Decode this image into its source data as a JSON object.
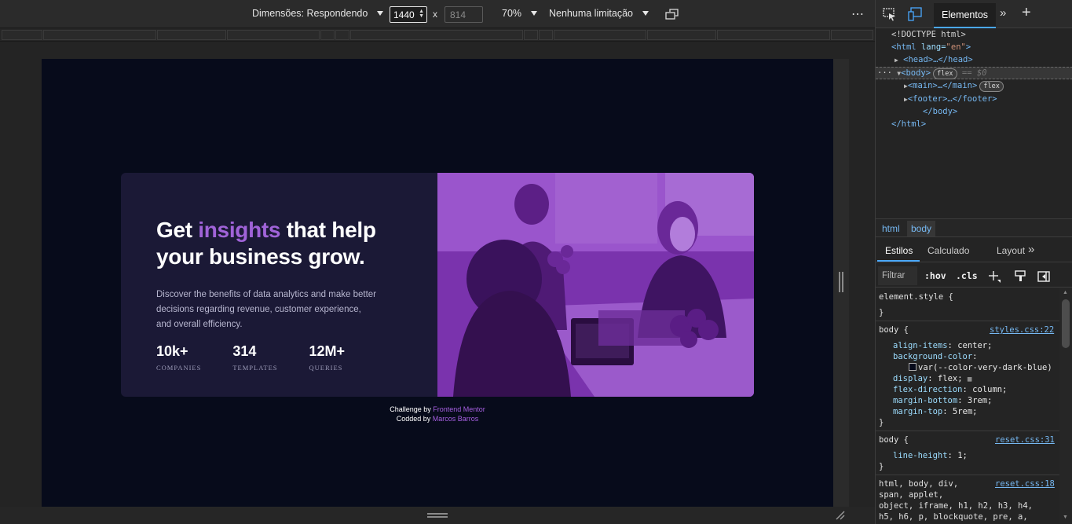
{
  "device_toolbar": {
    "dimensions_label": "Dimensões: Respondendo",
    "width": "1440",
    "times": "x",
    "height": "814",
    "zoom": "70%",
    "throttle": "Nenhuma limitação",
    "more": "⋯"
  },
  "page": {
    "headline_pre": "Get ",
    "headline_accent": "insights",
    "headline_post_line1": " that help",
    "headline_line2": "your business grow.",
    "description": "Discover the benefits of data analytics and make better decisions regarding revenue, customer experience, and overall efficiency.",
    "stats": [
      {
        "value": "10k+",
        "label": "COMPANIES"
      },
      {
        "value": "314",
        "label": "TEMPLATES"
      },
      {
        "value": "12M+",
        "label": "QUERIES"
      }
    ],
    "footer": {
      "challenge_prefix": "Challenge by ",
      "challenge_link": "Frontend Mentor",
      "coded_prefix": "Codded by ",
      "coded_link": "Marcos Barros"
    }
  },
  "devtools": {
    "tab_elements": "Elementos",
    "tab_more": "»",
    "tab_add": "+",
    "dom": {
      "doctype": "<!DOCTYPE html>",
      "html_open_tag": "<html",
      "html_attr": " lang=",
      "html_attr_val": "\"en\"",
      "html_close_bracket": ">",
      "head": "<head>…</head>",
      "body_open": "<body>",
      "body_badge": "flex",
      "body_eq": "== $0",
      "main": "<main>…</main>",
      "main_badge": "flex",
      "footer": "<footer>…</footer>",
      "body_close": "</body>",
      "html_close": "</html>",
      "dots": "···"
    },
    "breadcrumbs": [
      "html",
      "body"
    ],
    "style_tabs": [
      "Estilos",
      "Calculado",
      "Layout",
      "»"
    ],
    "filter_placeholder": "Filtrar",
    "hov": ":hov",
    "cls": ".cls",
    "rules": {
      "element_style": "element.style {",
      "close": "}",
      "r1_selector": "body {",
      "r1_source": "styles.css:22",
      "r1_props": [
        {
          "name": "align-items",
          "value": "center;"
        },
        {
          "name": "background-color",
          "value": ""
        },
        {
          "name": "display",
          "value": "flex;"
        },
        {
          "name": "flex-direction",
          "value": "column;"
        },
        {
          "name": "margin-bottom",
          "value": "3rem;"
        },
        {
          "name": "margin-top",
          "value": "5rem;"
        }
      ],
      "r1_var": "var(--color-very-dark-blue)",
      "r2_selector": "body {",
      "r2_source": "reset.css:31",
      "r2_prop": {
        "name": "line-height",
        "value": "1;"
      },
      "r3_selector_l1": "html, body, div,",
      "r3_source": "reset.css:18",
      "r3_selector_l2": "span, applet,",
      "r3_selector_l3": "object, iframe, h1, h2, h3, h4,",
      "r3_selector_l4": "h5, h6, p, blockquote, pre, a,"
    }
  },
  "colors": {
    "accent_purple": "#a063d8",
    "page_bg": "#070b1b",
    "card_bg": "#1b1936",
    "image_tint": "#8a3fbf",
    "devtools_link": "#76b8f2"
  }
}
